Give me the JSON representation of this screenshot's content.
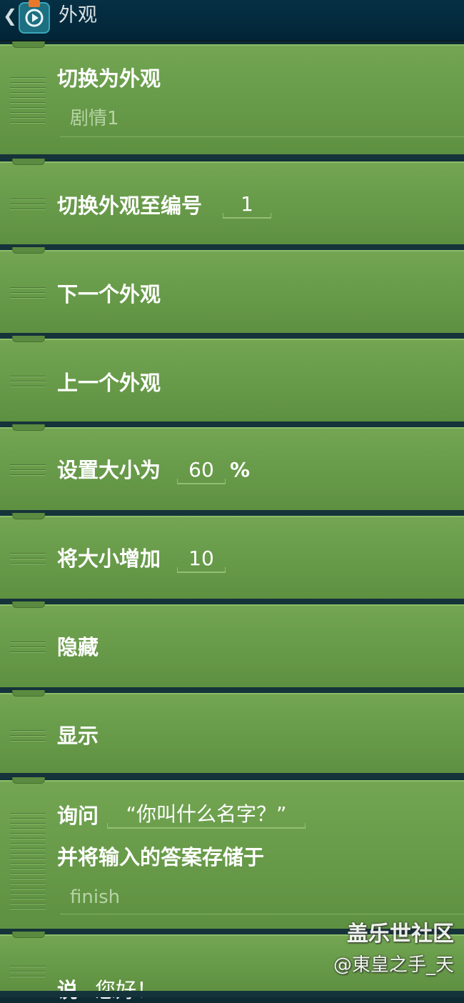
{
  "header": {
    "back_icon": "chevron-left-icon",
    "app_icon": "scratch-app-icon",
    "title": "外观"
  },
  "blocks": {
    "switch_costume": {
      "label": "切换为外观",
      "value": "剧情1"
    },
    "switch_costume_number": {
      "label": "切换外观至编号",
      "value": "1"
    },
    "next_costume": {
      "label": "下一个外观"
    },
    "previous_costume": {
      "label": "上一个外观"
    },
    "set_size": {
      "label": "设置大小为",
      "value": "60",
      "suffix": "%"
    },
    "change_size": {
      "label": "将大小增加",
      "value": "10"
    },
    "hide": {
      "label": "隐藏"
    },
    "show": {
      "label": "显示"
    },
    "ask": {
      "label": "询问",
      "value": "“你叫什么名字？”",
      "label2": "并将输入的答案存储于",
      "variable": "finish"
    },
    "say": {
      "label": "说",
      "value": "您好！"
    }
  },
  "watermark": {
    "line1": "盖乐世社区",
    "line2": "@東皇之手_天"
  }
}
